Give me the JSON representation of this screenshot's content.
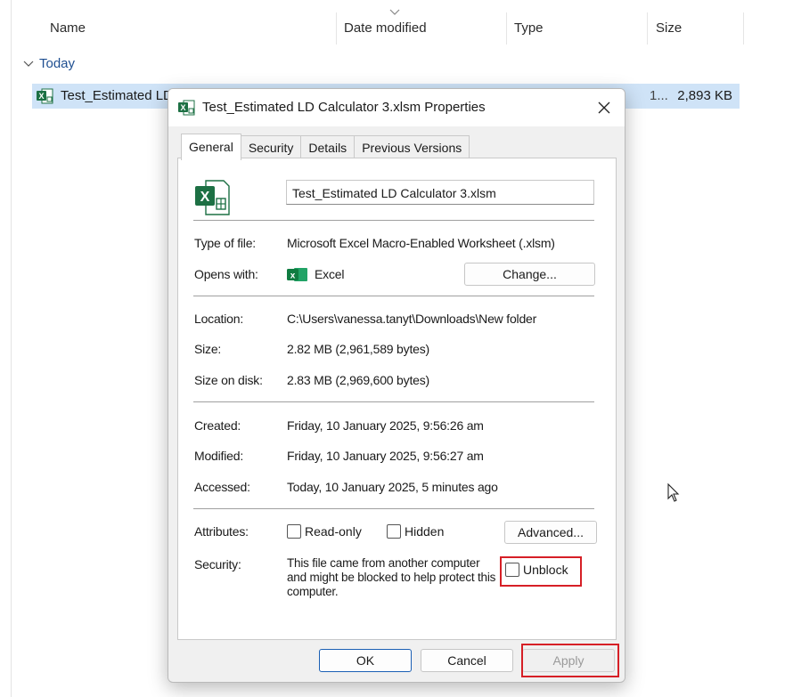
{
  "explorer": {
    "columns": {
      "name": "Name",
      "date_modified": "Date modified",
      "type": "Type",
      "size": "Size"
    },
    "group_label": "Today",
    "file": {
      "name": "Test_Estimated LD",
      "type_truncated": "1...",
      "size": "2,893 KB"
    }
  },
  "dialog": {
    "title": "Test_Estimated LD Calculator 3.xlsm Properties",
    "tabs": [
      "General",
      "Security",
      "Details",
      "Previous Versions"
    ],
    "active_tab": "General",
    "file_name": "Test_Estimated LD Calculator 3.xlsm",
    "fields": {
      "type_label": "Type of file:",
      "type_value": "Microsoft Excel Macro-Enabled Worksheet (.xlsm)",
      "opens_label": "Opens with:",
      "opens_value": "Excel",
      "change_button": "Change...",
      "location_label": "Location:",
      "location_value": "C:\\Users\\vanessa.tanyt\\Downloads\\New folder",
      "size_label": "Size:",
      "size_value": "2.82 MB (2,961,589 bytes)",
      "size_on_disk_label": "Size on disk:",
      "size_on_disk_value": "2.83 MB (2,969,600 bytes)",
      "created_label": "Created:",
      "created_value": "Friday, 10 January 2025, 9:56:26 am",
      "modified_label": "Modified:",
      "modified_value": "Friday, 10 January 2025, 9:56:27 am",
      "accessed_label": "Accessed:",
      "accessed_value": "Today, 10 January 2025, 5 minutes ago",
      "attributes_label": "Attributes:",
      "readonly_label": "Read-only",
      "hidden_label": "Hidden",
      "advanced_button": "Advanced...",
      "security_label": "Security:",
      "security_text": "This file came from another computer and might be blocked to help protect this computer.",
      "unblock_label": "Unblock"
    },
    "buttons": {
      "ok": "OK",
      "cancel": "Cancel",
      "apply": "Apply"
    }
  },
  "colors": {
    "highlight": "#d61f26",
    "excel_green": "#1d7044",
    "selection": "#cfe3f7"
  }
}
